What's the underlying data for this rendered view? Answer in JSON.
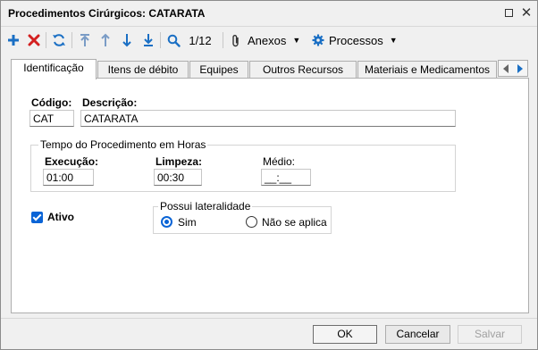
{
  "window": {
    "title": "Procedimentos Cirúrgicos: CATARATA"
  },
  "toolbar": {
    "record_position": "1/12",
    "anexos_label": "Anexos",
    "processos_label": "Processos",
    "colors": {
      "add": "#1a6fc4",
      "delete": "#d32020",
      "nav": "#1a6fc4",
      "refresh": "#1a6fc4"
    }
  },
  "tabs": [
    {
      "label": "Identificação",
      "active": true
    },
    {
      "label": "Itens de débito",
      "active": false
    },
    {
      "label": "Equipes",
      "active": false
    },
    {
      "label": "Outros Recursos",
      "active": false
    },
    {
      "label": "Materiais e Medicamentos",
      "active": false
    }
  ],
  "form": {
    "codigo_label": "Código:",
    "codigo_value": "CAT",
    "descricao_label": "Descrição:",
    "descricao_value": "CATARATA",
    "tempo_group_title": "Tempo do Procedimento em Horas",
    "execucao_label": "Execução:",
    "execucao_value": "01:00",
    "limpeza_label": "Limpeza:",
    "limpeza_value": "00:30",
    "medio_label": "Médio:",
    "medio_value": "__:__",
    "ativo_label": "Ativo",
    "ativo_checked": true,
    "lateralidade_title": "Possui lateralidade",
    "sim_label": "Sim",
    "nao_label": "Não se aplica",
    "lateralidade_selected": "Sim"
  },
  "footer": {
    "ok_label": "OK",
    "cancelar_label": "Cancelar",
    "salvar_label": "Salvar"
  },
  "colors": {
    "accent": "#0a64d6"
  }
}
